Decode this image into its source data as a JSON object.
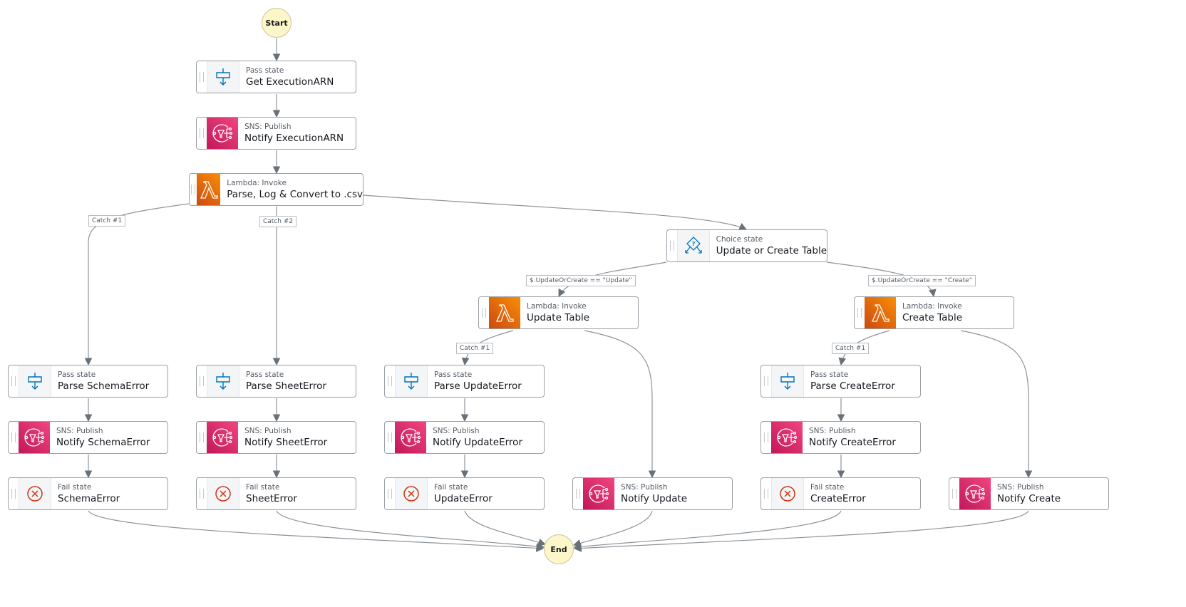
{
  "terminals": {
    "start": "Start",
    "end": "End"
  },
  "nodes": {
    "get_execution_arn": {
      "type": "Pass state",
      "name": "Get ExecutionARN",
      "icon": "pass-icon"
    },
    "notify_execution_arn": {
      "type": "SNS: Publish",
      "name": "Notify ExecutionARN",
      "icon": "sns-icon"
    },
    "parse_log_convert": {
      "type": "Lambda: Invoke",
      "name": "Parse, Log & Convert to .csv",
      "icon": "lambda-icon"
    },
    "update_or_create": {
      "type": "Choice state",
      "name": "Update or Create Table",
      "icon": "choice-icon"
    },
    "update_table": {
      "type": "Lambda: Invoke",
      "name": "Update Table",
      "icon": "lambda-icon"
    },
    "create_table": {
      "type": "Lambda: Invoke",
      "name": "Create Table",
      "icon": "lambda-icon"
    },
    "parse_schema_error": {
      "type": "Pass state",
      "name": "Parse SchemaError",
      "icon": "pass-icon"
    },
    "parse_sheet_error": {
      "type": "Pass state",
      "name": "Parse SheetError",
      "icon": "pass-icon"
    },
    "parse_update_error": {
      "type": "Pass state",
      "name": "Parse UpdateError",
      "icon": "pass-icon"
    },
    "parse_create_error": {
      "type": "Pass state",
      "name": "Parse CreateError",
      "icon": "pass-icon"
    },
    "notify_schema_error": {
      "type": "SNS: Publish",
      "name": "Notify SchemaError",
      "icon": "sns-icon"
    },
    "notify_sheet_error": {
      "type": "SNS: Publish",
      "name": "Notify SheetError",
      "icon": "sns-icon"
    },
    "notify_update_error": {
      "type": "SNS: Publish",
      "name": "Notify UpdateError",
      "icon": "sns-icon"
    },
    "notify_create_error": {
      "type": "SNS: Publish",
      "name": "Notify CreateError",
      "icon": "sns-icon"
    },
    "schema_error": {
      "type": "Fail state",
      "name": "SchemaError",
      "icon": "fail-icon"
    },
    "sheet_error": {
      "type": "Fail state",
      "name": "SheetError",
      "icon": "fail-icon"
    },
    "update_error": {
      "type": "Fail state",
      "name": "UpdateError",
      "icon": "fail-icon"
    },
    "create_error": {
      "type": "Fail state",
      "name": "CreateError",
      "icon": "fail-icon"
    },
    "notify_update": {
      "type": "SNS: Publish",
      "name": "Notify Update",
      "icon": "sns-icon"
    },
    "notify_create": {
      "type": "SNS: Publish",
      "name": "Notify Create",
      "icon": "sns-icon"
    }
  },
  "edge_labels": {
    "catch1": "Catch #1",
    "catch2": "Catch #2",
    "cond_update": "$.UpdateOrCreate == \"Update\"",
    "cond_create": "$.UpdateOrCreate == \"Create\"",
    "update_catch1": "Catch #1",
    "create_catch1": "Catch #1"
  },
  "edges": [
    [
      "start",
      "get_execution_arn"
    ],
    [
      "get_execution_arn",
      "notify_execution_arn"
    ],
    [
      "notify_execution_arn",
      "parse_log_convert"
    ],
    [
      "parse_log_convert",
      "parse_schema_error",
      "Catch #1"
    ],
    [
      "parse_log_convert",
      "parse_sheet_error",
      "Catch #2"
    ],
    [
      "parse_log_convert",
      "update_or_create"
    ],
    [
      "update_or_create",
      "update_table",
      "$.UpdateOrCreate == \"Update\""
    ],
    [
      "update_or_create",
      "create_table",
      "$.UpdateOrCreate == \"Create\""
    ],
    [
      "update_table",
      "parse_update_error",
      "Catch #1"
    ],
    [
      "update_table",
      "notify_update"
    ],
    [
      "create_table",
      "parse_create_error",
      "Catch #1"
    ],
    [
      "create_table",
      "notify_create"
    ],
    [
      "parse_schema_error",
      "notify_schema_error"
    ],
    [
      "notify_schema_error",
      "schema_error"
    ],
    [
      "parse_sheet_error",
      "notify_sheet_error"
    ],
    [
      "notify_sheet_error",
      "sheet_error"
    ],
    [
      "parse_update_error",
      "notify_update_error"
    ],
    [
      "notify_update_error",
      "update_error"
    ],
    [
      "parse_create_error",
      "notify_create_error"
    ],
    [
      "notify_create_error",
      "create_error"
    ],
    [
      "schema_error",
      "end"
    ],
    [
      "sheet_error",
      "end"
    ],
    [
      "update_error",
      "end"
    ],
    [
      "notify_update",
      "end"
    ],
    [
      "create_error",
      "end"
    ],
    [
      "notify_create",
      "end"
    ]
  ],
  "colors": {
    "edge": "#687078",
    "sns": "#e7157b",
    "lambda": "#ed7100",
    "pass_icon": "#0073bb",
    "fail_icon": "#d13212",
    "terminal_fill": "#fdf6c8"
  }
}
